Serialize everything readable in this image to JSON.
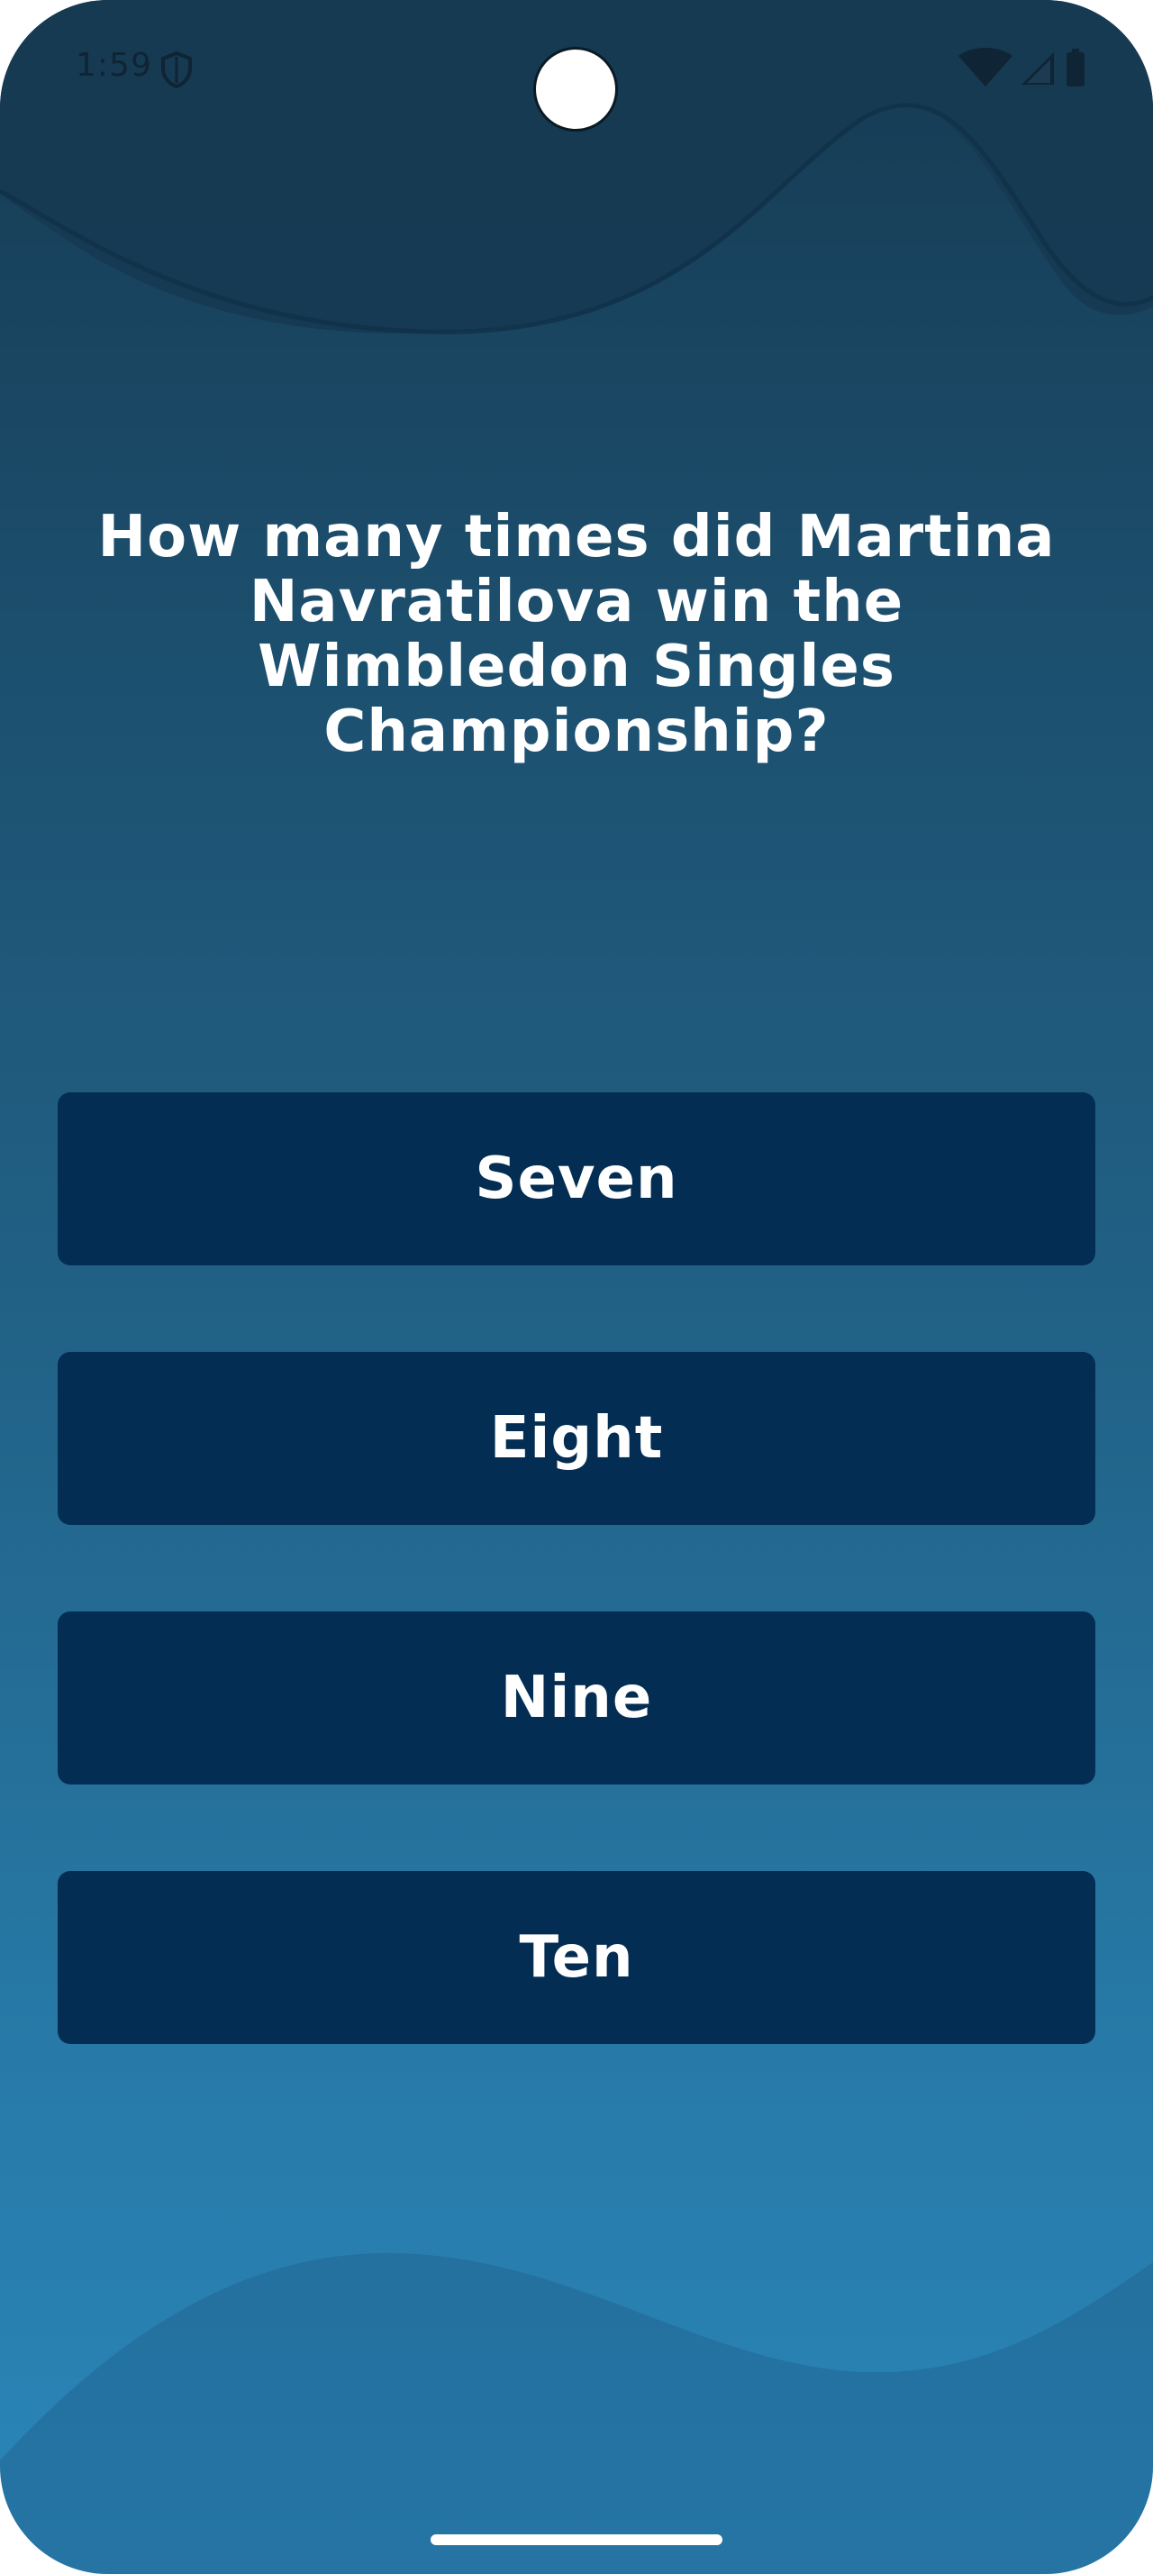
{
  "status_bar": {
    "time": "1:59",
    "icons": [
      "shield-icon",
      "wifi-icon",
      "signal-icon",
      "battery-icon"
    ]
  },
  "quiz": {
    "question": "How many times did Martina Navratilova win the Wimbledon Singles Championship?",
    "answers": [
      "Seven",
      "Eight",
      "Nine",
      "Ten"
    ]
  },
  "colors": {
    "background_top": "#163a52",
    "background_bottom": "#2a86b9",
    "answer_button": "#032d52",
    "text": "#ffffff"
  }
}
